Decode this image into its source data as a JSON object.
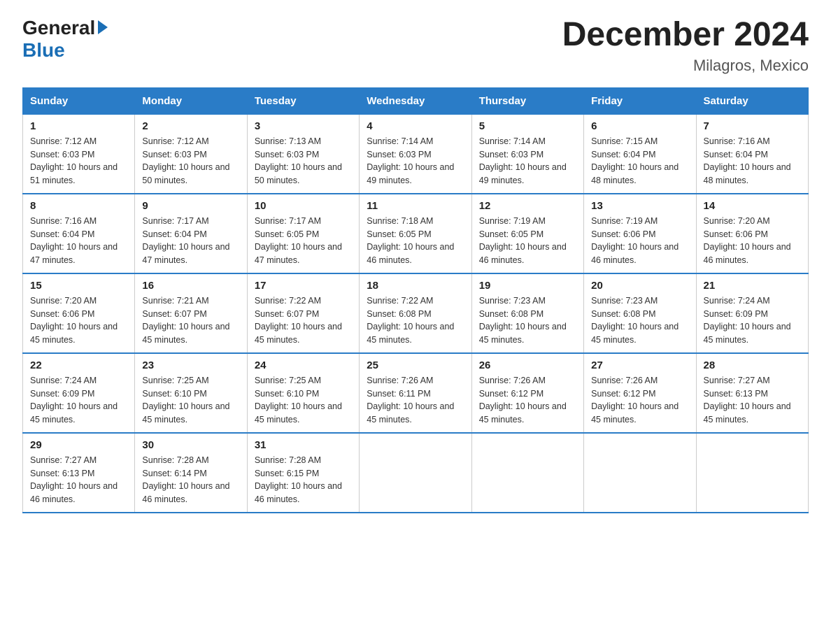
{
  "header": {
    "logo": {
      "general": "General",
      "blue": "Blue"
    },
    "title": "December 2024",
    "location": "Milagros, Mexico"
  },
  "days_of_week": [
    "Sunday",
    "Monday",
    "Tuesday",
    "Wednesday",
    "Thursday",
    "Friday",
    "Saturday"
  ],
  "weeks": [
    [
      {
        "day": "1",
        "sunrise": "7:12 AM",
        "sunset": "6:03 PM",
        "daylight": "10 hours and 51 minutes."
      },
      {
        "day": "2",
        "sunrise": "7:12 AM",
        "sunset": "6:03 PM",
        "daylight": "10 hours and 50 minutes."
      },
      {
        "day": "3",
        "sunrise": "7:13 AM",
        "sunset": "6:03 PM",
        "daylight": "10 hours and 50 minutes."
      },
      {
        "day": "4",
        "sunrise": "7:14 AM",
        "sunset": "6:03 PM",
        "daylight": "10 hours and 49 minutes."
      },
      {
        "day": "5",
        "sunrise": "7:14 AM",
        "sunset": "6:03 PM",
        "daylight": "10 hours and 49 minutes."
      },
      {
        "day": "6",
        "sunrise": "7:15 AM",
        "sunset": "6:04 PM",
        "daylight": "10 hours and 48 minutes."
      },
      {
        "day": "7",
        "sunrise": "7:16 AM",
        "sunset": "6:04 PM",
        "daylight": "10 hours and 48 minutes."
      }
    ],
    [
      {
        "day": "8",
        "sunrise": "7:16 AM",
        "sunset": "6:04 PM",
        "daylight": "10 hours and 47 minutes."
      },
      {
        "day": "9",
        "sunrise": "7:17 AM",
        "sunset": "6:04 PM",
        "daylight": "10 hours and 47 minutes."
      },
      {
        "day": "10",
        "sunrise": "7:17 AM",
        "sunset": "6:05 PM",
        "daylight": "10 hours and 47 minutes."
      },
      {
        "day": "11",
        "sunrise": "7:18 AM",
        "sunset": "6:05 PM",
        "daylight": "10 hours and 46 minutes."
      },
      {
        "day": "12",
        "sunrise": "7:19 AM",
        "sunset": "6:05 PM",
        "daylight": "10 hours and 46 minutes."
      },
      {
        "day": "13",
        "sunrise": "7:19 AM",
        "sunset": "6:06 PM",
        "daylight": "10 hours and 46 minutes."
      },
      {
        "day": "14",
        "sunrise": "7:20 AM",
        "sunset": "6:06 PM",
        "daylight": "10 hours and 46 minutes."
      }
    ],
    [
      {
        "day": "15",
        "sunrise": "7:20 AM",
        "sunset": "6:06 PM",
        "daylight": "10 hours and 45 minutes."
      },
      {
        "day": "16",
        "sunrise": "7:21 AM",
        "sunset": "6:07 PM",
        "daylight": "10 hours and 45 minutes."
      },
      {
        "day": "17",
        "sunrise": "7:22 AM",
        "sunset": "6:07 PM",
        "daylight": "10 hours and 45 minutes."
      },
      {
        "day": "18",
        "sunrise": "7:22 AM",
        "sunset": "6:08 PM",
        "daylight": "10 hours and 45 minutes."
      },
      {
        "day": "19",
        "sunrise": "7:23 AM",
        "sunset": "6:08 PM",
        "daylight": "10 hours and 45 minutes."
      },
      {
        "day": "20",
        "sunrise": "7:23 AM",
        "sunset": "6:08 PM",
        "daylight": "10 hours and 45 minutes."
      },
      {
        "day": "21",
        "sunrise": "7:24 AM",
        "sunset": "6:09 PM",
        "daylight": "10 hours and 45 minutes."
      }
    ],
    [
      {
        "day": "22",
        "sunrise": "7:24 AM",
        "sunset": "6:09 PM",
        "daylight": "10 hours and 45 minutes."
      },
      {
        "day": "23",
        "sunrise": "7:25 AM",
        "sunset": "6:10 PM",
        "daylight": "10 hours and 45 minutes."
      },
      {
        "day": "24",
        "sunrise": "7:25 AM",
        "sunset": "6:10 PM",
        "daylight": "10 hours and 45 minutes."
      },
      {
        "day": "25",
        "sunrise": "7:26 AM",
        "sunset": "6:11 PM",
        "daylight": "10 hours and 45 minutes."
      },
      {
        "day": "26",
        "sunrise": "7:26 AM",
        "sunset": "6:12 PM",
        "daylight": "10 hours and 45 minutes."
      },
      {
        "day": "27",
        "sunrise": "7:26 AM",
        "sunset": "6:12 PM",
        "daylight": "10 hours and 45 minutes."
      },
      {
        "day": "28",
        "sunrise": "7:27 AM",
        "sunset": "6:13 PM",
        "daylight": "10 hours and 45 minutes."
      }
    ],
    [
      {
        "day": "29",
        "sunrise": "7:27 AM",
        "sunset": "6:13 PM",
        "daylight": "10 hours and 46 minutes."
      },
      {
        "day": "30",
        "sunrise": "7:28 AM",
        "sunset": "6:14 PM",
        "daylight": "10 hours and 46 minutes."
      },
      {
        "day": "31",
        "sunrise": "7:28 AM",
        "sunset": "6:15 PM",
        "daylight": "10 hours and 46 minutes."
      },
      null,
      null,
      null,
      null
    ]
  ]
}
